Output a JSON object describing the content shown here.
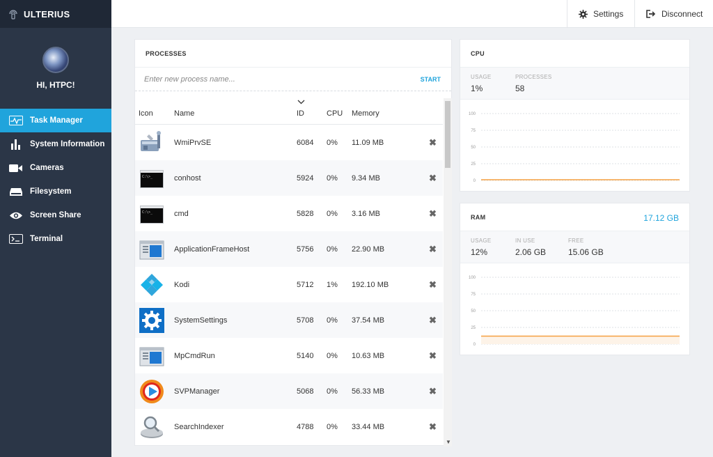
{
  "app": {
    "title": "ULTERIUS",
    "greeting": "HI, HTPC!"
  },
  "sidebar": {
    "items": [
      {
        "label": "Task Manager",
        "icon": "pulse-icon",
        "active": true
      },
      {
        "label": "System Information",
        "icon": "bar-chart-icon",
        "active": false
      },
      {
        "label": "Cameras",
        "icon": "video-camera-icon",
        "active": false
      },
      {
        "label": "Filesystem",
        "icon": "hard-drive-icon",
        "active": false
      },
      {
        "label": "Screen Share",
        "icon": "eye-icon",
        "active": false
      },
      {
        "label": "Terminal",
        "icon": "terminal-icon",
        "active": false
      }
    ]
  },
  "topbar": {
    "settings_label": "Settings",
    "disconnect_label": "Disconnect"
  },
  "processes": {
    "title": "PROCESSES",
    "input_placeholder": "Enter new process name...",
    "start_label": "START",
    "columns": {
      "icon": "Icon",
      "name": "Name",
      "id": "ID",
      "cpu": "CPU",
      "memory": "Memory"
    },
    "rows": [
      {
        "icon": "wmi-tools-icon",
        "name": "WmiPrvSE",
        "id": "6084",
        "cpu": "0%",
        "memory": "11.09 MB"
      },
      {
        "icon": "console-icon",
        "name": "conhost",
        "id": "5924",
        "cpu": "0%",
        "memory": "9.34 MB"
      },
      {
        "icon": "console-icon",
        "name": "cmd",
        "id": "5828",
        "cpu": "0%",
        "memory": "3.16 MB"
      },
      {
        "icon": "window-app-icon",
        "name": "ApplicationFrameHost",
        "id": "5756",
        "cpu": "0%",
        "memory": "22.90 MB"
      },
      {
        "icon": "kodi-icon",
        "name": "Kodi",
        "id": "5712",
        "cpu": "1%",
        "memory": "192.10 MB"
      },
      {
        "icon": "settings-gear-icon",
        "name": "SystemSettings",
        "id": "5708",
        "cpu": "0%",
        "memory": "37.54 MB"
      },
      {
        "icon": "window-app-icon",
        "name": "MpCmdRun",
        "id": "5140",
        "cpu": "0%",
        "memory": "10.63 MB"
      },
      {
        "icon": "svp-play-icon",
        "name": "SVPManager",
        "id": "5068",
        "cpu": "0%",
        "memory": "56.33 MB"
      },
      {
        "icon": "search-indexer-icon",
        "name": "SearchIndexer",
        "id": "4788",
        "cpu": "0%",
        "memory": "33.44 MB"
      }
    ]
  },
  "cpu": {
    "title": "CPU",
    "usage_label": "USAGE",
    "usage_value": "1%",
    "processes_label": "PROCESSES",
    "processes_value": "58"
  },
  "ram": {
    "title": "RAM",
    "total": "17.12 GB",
    "usage_label": "USAGE",
    "usage_value": "12%",
    "inuse_label": "IN USE",
    "inuse_value": "2.06 GB",
    "free_label": "FREE",
    "free_value": "15.06 GB"
  },
  "colors": {
    "accent": "#20a4dc",
    "sidebar": "#2b3647",
    "chart_line": "#f5a040"
  },
  "chart_data": [
    {
      "type": "line",
      "name": "cpu-usage",
      "y_ticks": [
        "100",
        "75",
        "50",
        "25",
        "0"
      ],
      "ylim": [
        0,
        100
      ],
      "values": [
        1,
        1,
        1,
        1,
        1,
        1,
        1,
        1,
        1,
        1
      ],
      "grid": true
    },
    {
      "type": "area",
      "name": "ram-usage",
      "y_ticks": [
        "100",
        "75",
        "50",
        "25",
        "0"
      ],
      "ylim": [
        0,
        100
      ],
      "values": [
        12,
        12,
        12,
        12,
        12,
        12,
        12,
        12,
        12,
        12
      ],
      "grid": true
    }
  ]
}
